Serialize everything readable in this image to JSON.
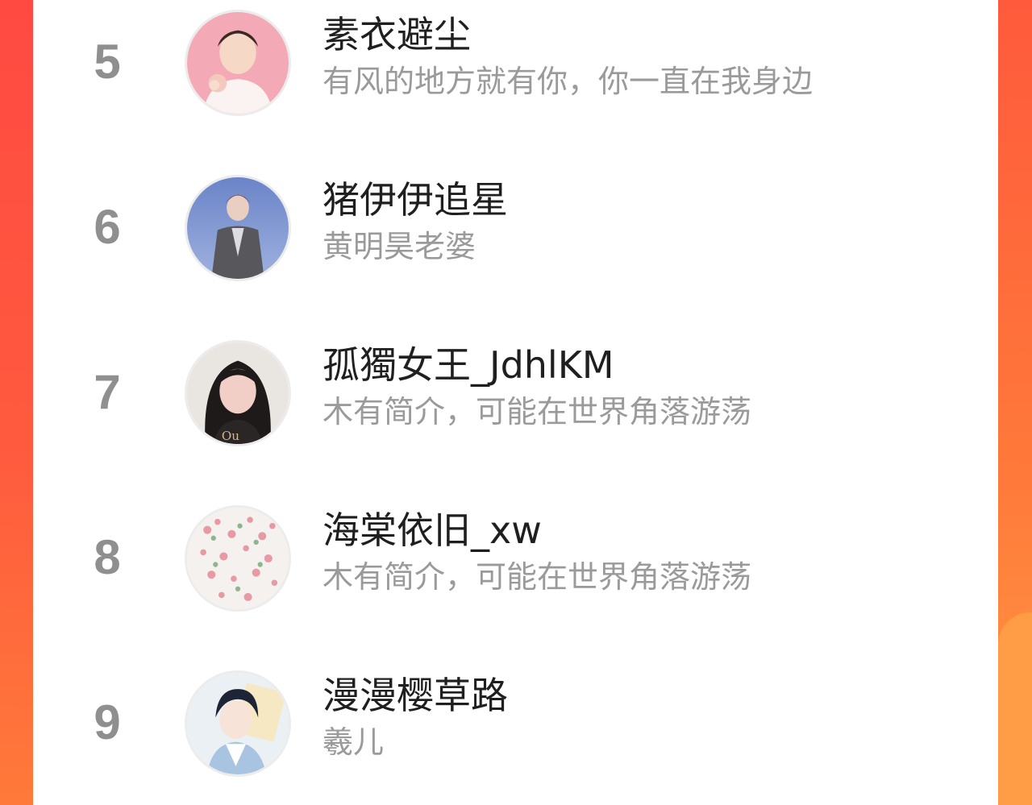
{
  "ranking": {
    "rows": [
      {
        "rank": "5",
        "name": "素衣避尘",
        "bio": "有风的地方就有你，你一直在我身边",
        "avatar_icon": "avatar-pink-portrait"
      },
      {
        "rank": "6",
        "name": "猪伊伊追星",
        "bio": "黄明昊老婆",
        "avatar_icon": "avatar-stage-portrait"
      },
      {
        "rank": "7",
        "name": "孤獨女王_JdhlKM",
        "bio": "木有简介，可能在世界角落游荡",
        "avatar_icon": "avatar-selfie-portrait"
      },
      {
        "rank": "8",
        "name": "海棠依旧_xw",
        "bio": "木有简介，可能在世界角落游荡",
        "avatar_icon": "avatar-blossom-flowers"
      },
      {
        "rank": "9",
        "name": "漫漫樱草路",
        "bio": "羲儿",
        "avatar_icon": "avatar-anime-character"
      }
    ]
  },
  "colors": {
    "background_accent": "#ff4a42",
    "rank_text": "#8f8f8f",
    "name_text": "#1f1f1f",
    "bio_text": "#9a9a9a"
  }
}
